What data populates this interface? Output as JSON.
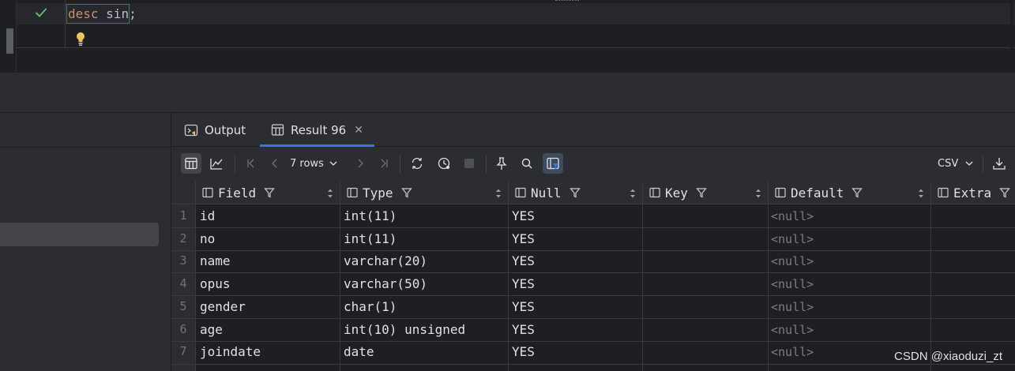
{
  "editor": {
    "keyword": "desc",
    "table": "sin",
    "terminator": ";"
  },
  "tabs": [
    {
      "label": "Output"
    },
    {
      "label": "Result 96"
    }
  ],
  "toolbar": {
    "rows_label": "7 rows",
    "export_format": "CSV"
  },
  "columns": [
    "Field",
    "Type",
    "Null",
    "Key",
    "Default",
    "Extra"
  ],
  "rows": [
    {
      "n": "1",
      "field": "id",
      "type": "int(11)",
      "null": "YES",
      "key": "",
      "default": "<null>",
      "extra": ""
    },
    {
      "n": "2",
      "field": "no",
      "type": "int(11)",
      "null": "YES",
      "key": "",
      "default": "<null>",
      "extra": ""
    },
    {
      "n": "3",
      "field": "name",
      "type": "varchar(20)",
      "null": "YES",
      "key": "",
      "default": "<null>",
      "extra": ""
    },
    {
      "n": "4",
      "field": "opus",
      "type": "varchar(50)",
      "null": "YES",
      "key": "",
      "default": "<null>",
      "extra": ""
    },
    {
      "n": "5",
      "field": "gender",
      "type": "char(1)",
      "null": "YES",
      "key": "",
      "default": "<null>",
      "extra": ""
    },
    {
      "n": "6",
      "field": "age",
      "type": "int(10) unsigned",
      "null": "YES",
      "key": "",
      "default": "<null>",
      "extra": ""
    },
    {
      "n": "7",
      "field": "joindate",
      "type": "date",
      "null": "YES",
      "key": "",
      "default": "<null>",
      "extra": ""
    }
  ],
  "watermark": "CSDN @xiaoduzi_zt",
  "colors": {
    "accent": "#3574f0",
    "keyword": "#cf8e6d",
    "success": "#5fb865",
    "bulb": "#f2c55c"
  }
}
